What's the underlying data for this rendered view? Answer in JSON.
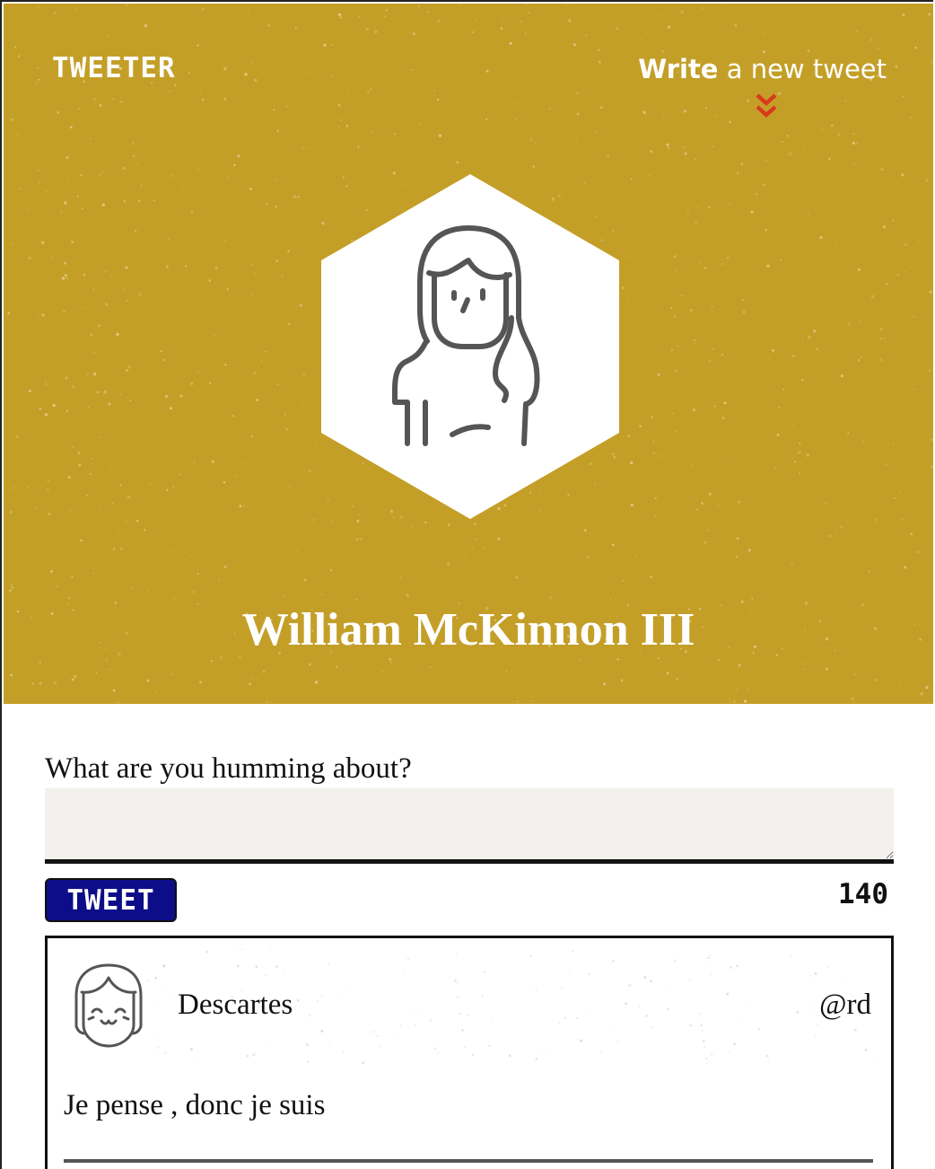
{
  "app": {
    "brand": "TWEETER",
    "nav": {
      "write_strong": "Write",
      "write_rest": " a new tweet"
    },
    "colors": {
      "header_bg": "#c49f28",
      "button_bg": "#0d0d8a",
      "accent_red": "#d93a1c",
      "input_bg": "#f3f1ed"
    }
  },
  "profile": {
    "name": "William McKinnon III",
    "avatar_icon": "woman-avatar-icon"
  },
  "compose": {
    "label": "What are you humming about?",
    "value": "",
    "button_label": "TWEET",
    "char_count": "140"
  },
  "tweets": [
    {
      "author": "Descartes",
      "handle": "@rd",
      "content": "Je pense , donc je suis",
      "avatar_icon": "girl-avatar-icon"
    }
  ]
}
